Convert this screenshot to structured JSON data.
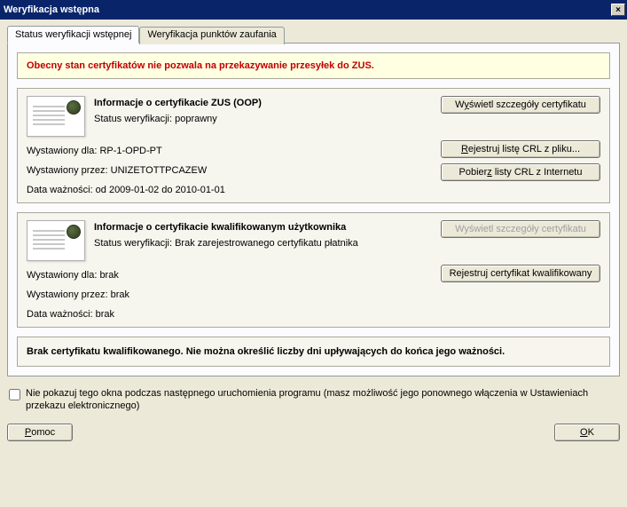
{
  "window": {
    "title": "Weryfikacja wstępna",
    "close_label": "×"
  },
  "tabs": {
    "tab1": "Status weryfikacji wstępnej",
    "tab2": "Weryfikacja punktów zaufania"
  },
  "status_message": "Obecny stan certyfikatów nie pozwala na przekazywanie przesyłek do ZUS.",
  "cert1": {
    "title": "Informacje o certyfikacie ZUS (OOP)",
    "status_prefix": "Status weryfikacji: ",
    "status_value": "poprawny",
    "issued_to_prefix": "Wystawiony dla: ",
    "issued_to": "RP-1-OPD-PT",
    "issued_by_prefix": "Wystawiony przez: ",
    "issued_by": "UNIZETOTTPCAZEW",
    "valid_prefix": "Data ważności: ",
    "valid": "od 2009-01-02 do 2010-01-01",
    "btn_details_pre": "W",
    "btn_details_u": "y",
    "btn_details_post": "świetl szczegóły certyfikatu",
    "btn_crl_file_u": "R",
    "btn_crl_file_post": "ejestruj listę CRL z pliku...",
    "btn_crl_net_pre": "Pobier",
    "btn_crl_net_u": "z",
    "btn_crl_net_post": " listy CRL z Internetu"
  },
  "cert2": {
    "title": "Informacje o certyfikacie kwalifikowanym użytkownika",
    "status_prefix": "Status weryfikacji: ",
    "status_value": "Brak zarejestrowanego certyfikatu płatnika",
    "issued_to_prefix": "Wystawiony dla: ",
    "issued_to": "brak",
    "issued_by_prefix": "Wystawiony przez: ",
    "issued_by": "brak",
    "valid_prefix": "Data ważności: ",
    "valid": "brak",
    "btn_details": "Wyświetl szczegóły certyfikatu",
    "btn_register_pre": "Re",
    "btn_register_u": "j",
    "btn_register_post": "estruj certyfikat kwalifikowany"
  },
  "bottom_info": "Brak certyfikatu kwalifikowanego. Nie można określić liczby dni upływających do końca jego ważności.",
  "checkbox_label": "Nie pokazuj tego okna podczas następnego uruchomienia programu (masz możliwość jego ponownego włączenia w Ustawieniach przekazu elektronicznego)",
  "buttons": {
    "help_u": "P",
    "help_post": "omoc",
    "ok_u": "O",
    "ok_post": "K"
  }
}
